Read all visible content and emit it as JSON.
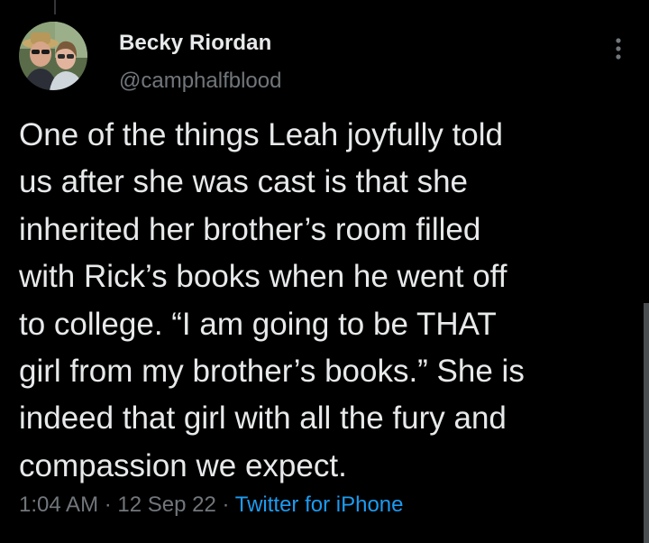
{
  "author": {
    "display_name": "Becky Riordan",
    "handle": "@camphalfblood",
    "avatar_icon": "profile-photo"
  },
  "more_icon": "more-options-icon",
  "tweet": {
    "lines": [
      "One of the things Leah joyfully told",
      "us after she was cast is that she",
      "inherited her brother’s room filled",
      "with Rick’s books when he went off",
      "to college.  “I am going to be THAT",
      "girl from my brother’s books.”  She is",
      "indeed that girl with all the fury and",
      "compassion we expect."
    ]
  },
  "meta": {
    "time": "1:04 AM",
    "sep1": " · ",
    "date": "12 Sep 22",
    "sep2": " · ",
    "source": "Twitter for iPhone"
  },
  "colors": {
    "background": "#000000",
    "text": "#e7e9ea",
    "secondary": "#71767b",
    "link": "#1d9bf0"
  }
}
